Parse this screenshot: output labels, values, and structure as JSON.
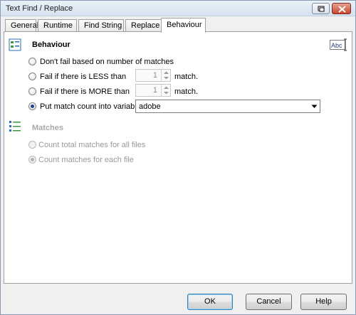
{
  "window": {
    "title": "Text Find / Replace"
  },
  "tabs": [
    {
      "label": "General"
    },
    {
      "label": "Runtime"
    },
    {
      "label": "Find String"
    },
    {
      "label": "Replace"
    },
    {
      "label": "Behaviour",
      "active": true
    }
  ],
  "behaviour": {
    "title": "Behaviour",
    "options": [
      {
        "label": "Don't fail based on number of matches",
        "checked": false
      },
      {
        "label": "Fail if there is LESS than",
        "checked": false,
        "count": "1",
        "suffix": "match."
      },
      {
        "label": "Fail if there is MORE than",
        "checked": false,
        "count": "1",
        "suffix": "match."
      },
      {
        "label": "Put match count into variable",
        "checked": true,
        "variable": "adobe"
      }
    ]
  },
  "matches": {
    "title": "Matches",
    "enabled": false,
    "options": [
      {
        "label": "Count total matches for all files",
        "checked": false
      },
      {
        "label": "Count matches for each file",
        "checked": true
      }
    ]
  },
  "buttons": {
    "ok": "OK",
    "cancel": "Cancel",
    "help": "Help"
  },
  "icons": {
    "behaviour": "settings-list-icon",
    "matches": "list-icon",
    "text_field": "text-field-icon"
  },
  "colors": {
    "accent": "#1f3f8f",
    "disabled_text": "#9a9a9a"
  }
}
